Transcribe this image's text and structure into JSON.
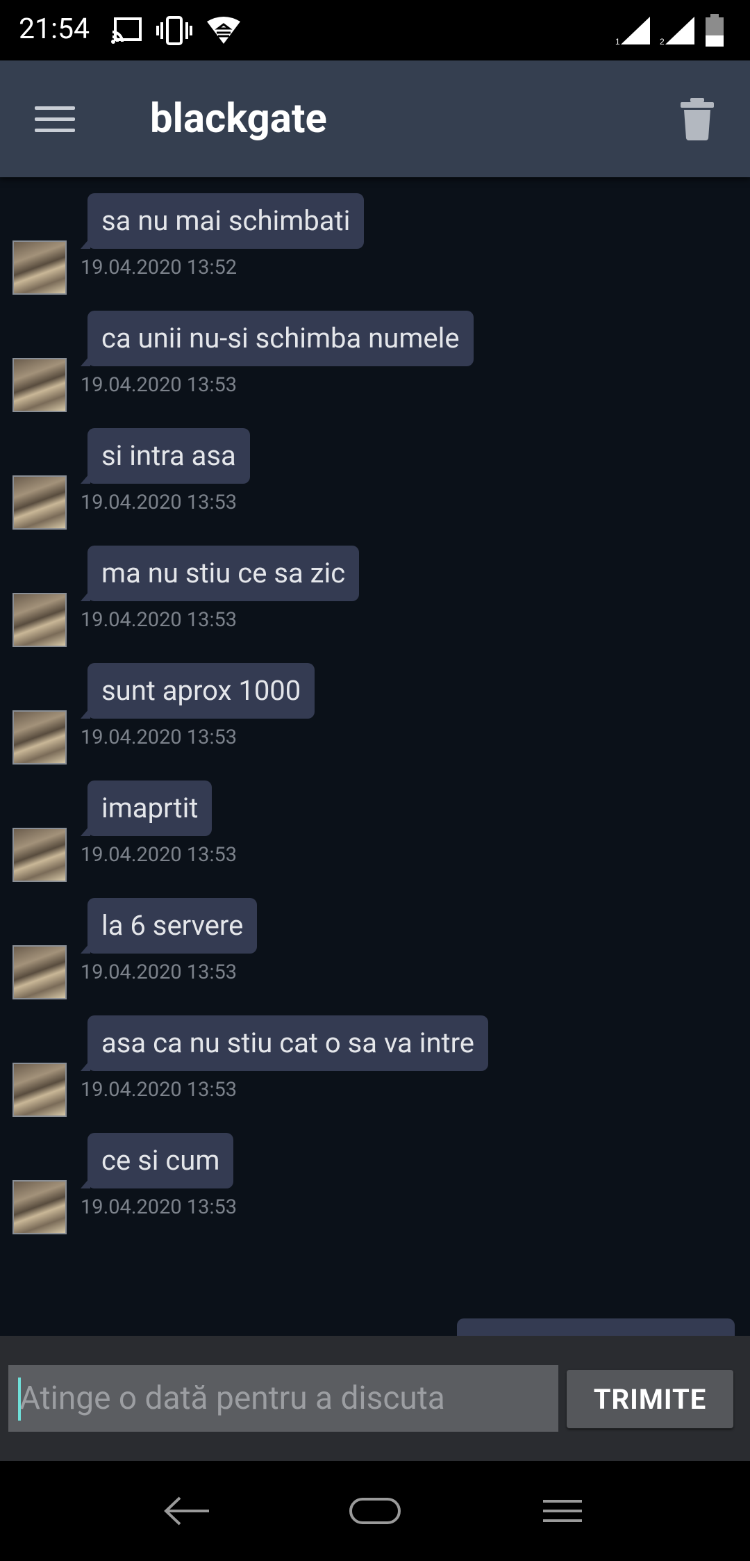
{
  "status_bar": {
    "time": "21:54"
  },
  "app_bar": {
    "title": "blackgate"
  },
  "messages": [
    {
      "text": "",
      "timestamp": "19.04.2020 13:52"
    },
    {
      "text": "sa nu mai schimbati",
      "timestamp": "19.04.2020 13:52"
    },
    {
      "text": "ca unii nu-si schimba numele",
      "timestamp": "19.04.2020 13:53"
    },
    {
      "text": "si intra asa",
      "timestamp": "19.04.2020 13:53"
    },
    {
      "text": "ma nu stiu ce sa zic",
      "timestamp": "19.04.2020 13:53"
    },
    {
      "text": "sunt aprox 1000",
      "timestamp": "19.04.2020 13:53"
    },
    {
      "text": "imaprtit",
      "timestamp": "19.04.2020 13:53"
    },
    {
      "text": "la 6 servere",
      "timestamp": "19.04.2020 13:53"
    },
    {
      "text": "asa ca nu stiu cat o sa va intre",
      "timestamp": "19.04.2020 13:53"
    },
    {
      "text": "ce si cum",
      "timestamp": "19.04.2020 13:53"
    }
  ],
  "composer": {
    "placeholder": "Atinge o dată pentru a discuta",
    "send_label": "TRIMITE"
  },
  "colors": {
    "app_bar": "#353f50",
    "chat_background": "#0b1119",
    "bubble": "#343b52",
    "timestamp": "#7c828b"
  }
}
